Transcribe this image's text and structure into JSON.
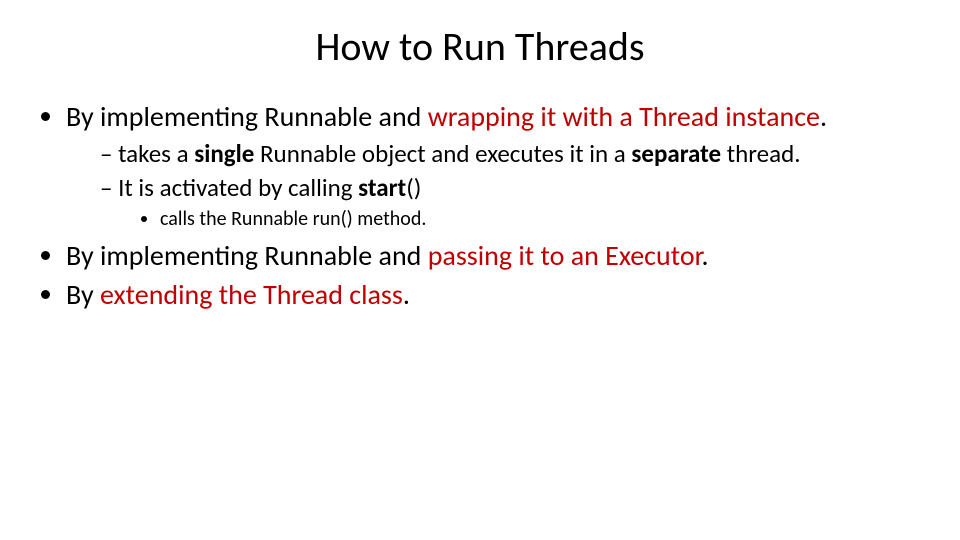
{
  "title": "How to Run Threads",
  "bullets": {
    "b1_pre": "By implementing Runnable and ",
    "b1_red": "wrapping it with a Thread instance",
    "b1_post": ".",
    "b1_sub1_a": "takes a ",
    "b1_sub1_b1": "single",
    "b1_sub1_c": " Runnable object and executes it in a ",
    "b1_sub1_b2": "separate",
    "b1_sub1_d": " thread.",
    "b1_sub2_a": "It is activated by calling ",
    "b1_sub2_b": "start",
    "b1_sub2_c": "()",
    "b1_sub2_sub1": "calls the Runnable run() method.",
    "b2_pre": "By implementing Runnable and ",
    "b2_red": "passing it to an Executor",
    "b2_post": ".",
    "b3_pre": "By ",
    "b3_red": "extending the Thread class",
    "b3_post": "."
  }
}
